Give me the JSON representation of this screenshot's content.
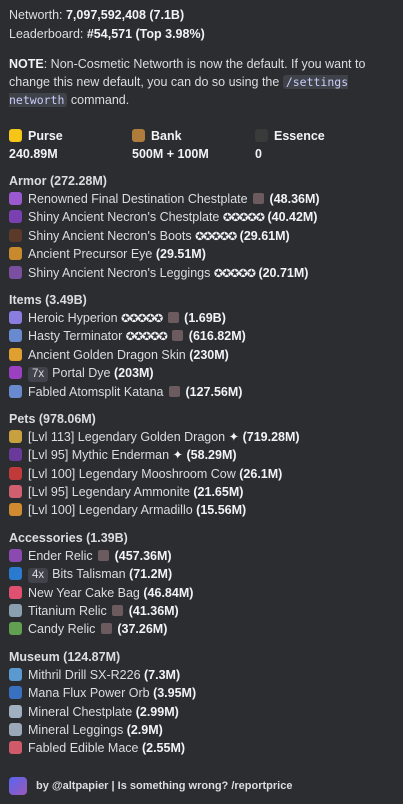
{
  "header": {
    "networth_label": "Networth:",
    "networth_value": "7,097,592,408 (7.1B)",
    "leaderboard_label": "Leaderboard:",
    "leaderboard_value": "#54,571 (Top 3.98%)"
  },
  "note": {
    "label": "NOTE",
    "text1": ": Non-Cosmetic Networth is now the default. If you want to change this new default, you can do so using the",
    "command": "/settings networth",
    "text2": "command."
  },
  "stats": [
    {
      "label": "Purse",
      "value": "240.89M",
      "icon": "gold-ingot-icon",
      "color": "#f5c518"
    },
    {
      "label": "Bank",
      "value": "500M + 100M",
      "icon": "money-bag-icon",
      "color": "#b07c3c"
    },
    {
      "label": "Essence",
      "value": "0",
      "icon": "wither-skull-icon",
      "color": "#3a3a3a"
    }
  ],
  "sections": [
    {
      "title": "Armor (272.28M)",
      "items": [
        {
          "icon_color": "#9b59d0",
          "name": "Renowned Final Destination Chestplate",
          "gem": true,
          "stars": "",
          "badge": "",
          "extra": "",
          "value": "(48.36M)"
        },
        {
          "icon_color": "#7a3fb0",
          "name": "Shiny Ancient Necron's Chestplate",
          "gem": false,
          "stars": "✪✪✪✪✪",
          "badge": "",
          "extra": "",
          "value": "(40.42M)"
        },
        {
          "icon_color": "#5b3a2a",
          "name": "Shiny Ancient Necron's Boots",
          "gem": false,
          "stars": "✪✪✪✪✪",
          "badge": "",
          "extra": "",
          "value": "(29.61M)"
        },
        {
          "icon_color": "#c98a2e",
          "name": "Ancient Precursor Eye",
          "gem": false,
          "stars": "",
          "badge": "",
          "extra": "",
          "value": "(29.51M)"
        },
        {
          "icon_color": "#7a4fa0",
          "name": "Shiny Ancient Necron's Leggings",
          "gem": false,
          "stars": "✪✪✪✪✪",
          "badge": "",
          "extra": "",
          "value": "(20.71M)"
        }
      ]
    },
    {
      "title": "Items (3.49B)",
      "items": [
        {
          "icon_color": "#8a7de0",
          "name": "Heroic Hyperion",
          "gem": true,
          "stars": "✪✪✪✪✪",
          "badge": "",
          "extra": "",
          "value": "(1.69B)"
        },
        {
          "icon_color": "#6a8ad0",
          "name": "Hasty Terminator",
          "gem": true,
          "stars": "✪✪✪✪✪",
          "badge": "",
          "extra": "",
          "value": "(616.82M)"
        },
        {
          "icon_color": "#e0a030",
          "name": "Ancient Golden Dragon Skin",
          "gem": false,
          "stars": "",
          "badge": "",
          "extra": "",
          "value": "(230M)"
        },
        {
          "icon_color": "#9a40c0",
          "name": "Portal Dye",
          "gem": false,
          "stars": "",
          "badge": "7x",
          "extra": "",
          "value": "(203M)"
        },
        {
          "icon_color": "#6a8ad0",
          "name": "Fabled Atomsplit Katana",
          "gem": true,
          "stars": "",
          "badge": "",
          "extra": "",
          "value": "(127.56M)"
        }
      ]
    },
    {
      "title": "Pets (978.06M)",
      "items": [
        {
          "icon_color": "#c8a040",
          "name": "[Lvl 113] Legendary Golden Dragon",
          "gem": false,
          "stars": "",
          "badge": "",
          "extra": "✦",
          "value": "(719.28M)"
        },
        {
          "icon_color": "#6a3a9a",
          "name": "[Lvl 95] Mythic Enderman",
          "gem": false,
          "stars": "",
          "badge": "",
          "extra": "✦",
          "value": "(58.29M)"
        },
        {
          "icon_color": "#c03a3a",
          "name": "[Lvl 100] Legendary Mooshroom Cow",
          "gem": false,
          "stars": "",
          "badge": "",
          "extra": "",
          "value": "(26.1M)"
        },
        {
          "icon_color": "#d06070",
          "name": "[Lvl 95] Legendary Ammonite",
          "gem": false,
          "stars": "",
          "badge": "",
          "extra": "",
          "value": "(21.65M)"
        },
        {
          "icon_color": "#d08a30",
          "name": "[Lvl 100] Legendary Armadillo",
          "gem": false,
          "stars": "",
          "badge": "",
          "extra": "",
          "value": "(15.56M)"
        }
      ]
    },
    {
      "title": "Accessories (1.39B)",
      "items": [
        {
          "icon_color": "#8a4ab0",
          "name": "Ender Relic",
          "gem": true,
          "stars": "",
          "badge": "",
          "extra": "",
          "value": "(457.36M)"
        },
        {
          "icon_color": "#2a7ad0",
          "name": "Bits Talisman",
          "gem": false,
          "stars": "",
          "badge": "4x",
          "extra": "",
          "value": "(71.2M)"
        },
        {
          "icon_color": "#e05070",
          "name": "New Year Cake Bag",
          "gem": false,
          "stars": "",
          "badge": "",
          "extra": "",
          "value": "(46.84M)"
        },
        {
          "icon_color": "#8aa0b0",
          "name": "Titanium Relic",
          "gem": true,
          "stars": "",
          "badge": "",
          "extra": "",
          "value": "(41.36M)"
        },
        {
          "icon_color": "#60a050",
          "name": "Candy Relic",
          "gem": true,
          "stars": "",
          "badge": "",
          "extra": "",
          "value": "(37.26M)"
        }
      ]
    },
    {
      "title": "Museum (124.87M)",
      "items": [
        {
          "icon_color": "#5a9ad0",
          "name": "Mithril Drill SX-R226",
          "gem": false,
          "stars": "",
          "badge": "",
          "extra": "",
          "value": "(7.3M)"
        },
        {
          "icon_color": "#3a70c0",
          "name": "Mana Flux Power Orb",
          "gem": false,
          "stars": "",
          "badge": "",
          "extra": "",
          "value": "(3.95M)"
        },
        {
          "icon_color": "#a0b0c0",
          "name": "Mineral Chestplate",
          "gem": false,
          "stars": "",
          "badge": "",
          "extra": "",
          "value": "(2.99M)"
        },
        {
          "icon_color": "#9aa8b8",
          "name": "Mineral Leggings",
          "gem": false,
          "stars": "",
          "badge": "",
          "extra": "",
          "value": "(2.9M)"
        },
        {
          "icon_color": "#d05a6a",
          "name": "Fabled Edible Mace",
          "gem": false,
          "stars": "",
          "badge": "",
          "extra": "",
          "value": "(2.55M)"
        }
      ]
    }
  ],
  "footer": {
    "text": "by @altpapier | Is something wrong? /reportprice"
  }
}
